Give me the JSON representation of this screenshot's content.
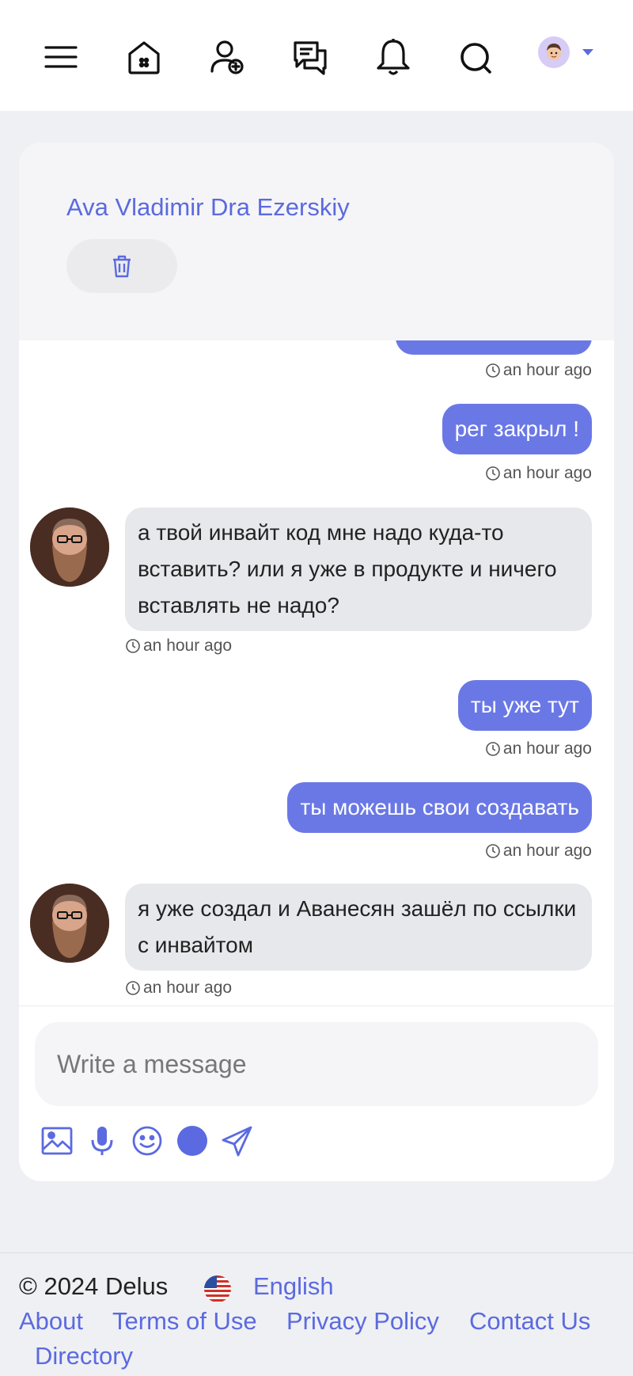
{
  "nav": {
    "icons": [
      "menu-icon",
      "home-icon",
      "add-friend-icon",
      "messages-icon",
      "notifications-icon",
      "search-icon"
    ],
    "accent": "#5b6ae0"
  },
  "chat": {
    "contact_name": "Ava Vladimir Dra Ezerskiy",
    "messages": [
      {
        "direction": "out",
        "text": "",
        "time": "an hour ago"
      },
      {
        "direction": "out",
        "text": "рег закрыл !",
        "time": "an hour ago"
      },
      {
        "direction": "in",
        "text": "а твой инвайт код мне надо куда-то вставить? или я уже в продукте и ничего вставлять не надо?",
        "time": "an hour ago"
      },
      {
        "direction": "out",
        "text": "ты уже тут",
        "time": "an hour ago"
      },
      {
        "direction": "out",
        "text": "ты можешь свои создавать",
        "time": "an hour ago"
      },
      {
        "direction": "in",
        "text": "я уже создал и Аванесян зашёл по ссылки с инвайтом",
        "time": "an hour ago"
      }
    ],
    "bubble_out_color": "#6a78e6",
    "bubble_in_color": "#e7e8ec"
  },
  "composer": {
    "placeholder": "Write a message",
    "tools": [
      "image-icon",
      "microphone-icon",
      "emoji-icon",
      "record-icon",
      "send-icon"
    ]
  },
  "footer": {
    "copyright": "© 2024 Delus",
    "language": "English",
    "links": [
      "About",
      "Terms of Use",
      "Privacy Policy",
      "Contact Us",
      "Directory"
    ]
  }
}
